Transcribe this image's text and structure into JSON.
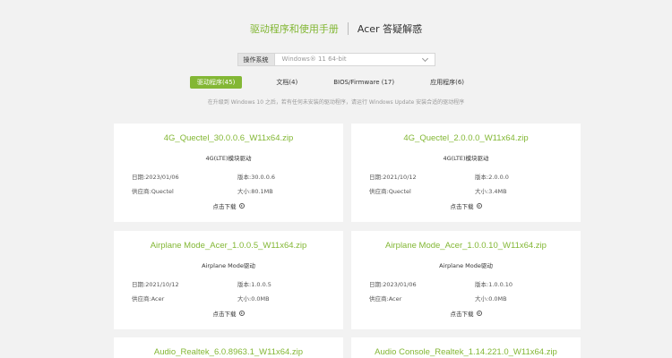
{
  "header": {
    "tab_drivers": "驱动程序和使用手册",
    "tab_faq": "Acer 答疑解惑"
  },
  "os": {
    "label": "操作系统",
    "selected": "Windows® 11 64-bit"
  },
  "categories": [
    {
      "label": "驱动程序(45)",
      "active": true
    },
    {
      "label": "文档(4)",
      "active": false
    },
    {
      "label": "BIOS/Firmware (17)",
      "active": false
    },
    {
      "label": "应用程序(6)",
      "active": false
    }
  ],
  "notice": "在升级到 Windows 10 之后，若有任何未安装的驱动程序，请运行 Windows Update 安装合适的驱动程序",
  "cards": [
    {
      "title": "4G_Quectel_30.0.0.6_W11x64.zip",
      "subtitle": "4G(LTE)模块驱动",
      "date": "日期:2023/01/06",
      "version": "版本:30.0.0.6",
      "vendor": "供应商:Quectel",
      "size": "大小:80.1MB",
      "download": "点击下载"
    },
    {
      "title": "4G_Quectel_2.0.0.0_W11x64.zip",
      "subtitle": "4G(LTE)模块驱动",
      "date": "日期:2021/10/12",
      "version": "版本:2.0.0.0",
      "vendor": "供应商:Quectel",
      "size": "大小:3.4MB",
      "download": "点击下载"
    },
    {
      "title": "Airplane Mode_Acer_1.0.0.5_W11x64.zip",
      "subtitle": "Airplane Mode驱动",
      "date": "日期:2021/10/12",
      "version": "版本:1.0.0.5",
      "vendor": "供应商:Acer",
      "size": "大小:0.0MB",
      "download": "点击下载"
    },
    {
      "title": "Airplane Mode_Acer_1.0.0.10_W11x64.zip",
      "subtitle": "Airplane Mode驱动",
      "date": "日期:2023/01/06",
      "version": "版本:1.0.0.10",
      "vendor": "供应商:Acer",
      "size": "大小:0.0MB",
      "download": "点击下载"
    },
    {
      "title": "Audio_Realtek_6.0.8963.1_W11x64.zip"
    },
    {
      "title": "Audio Console_Realtek_1.14.221.0_W11x64.zip"
    }
  ]
}
